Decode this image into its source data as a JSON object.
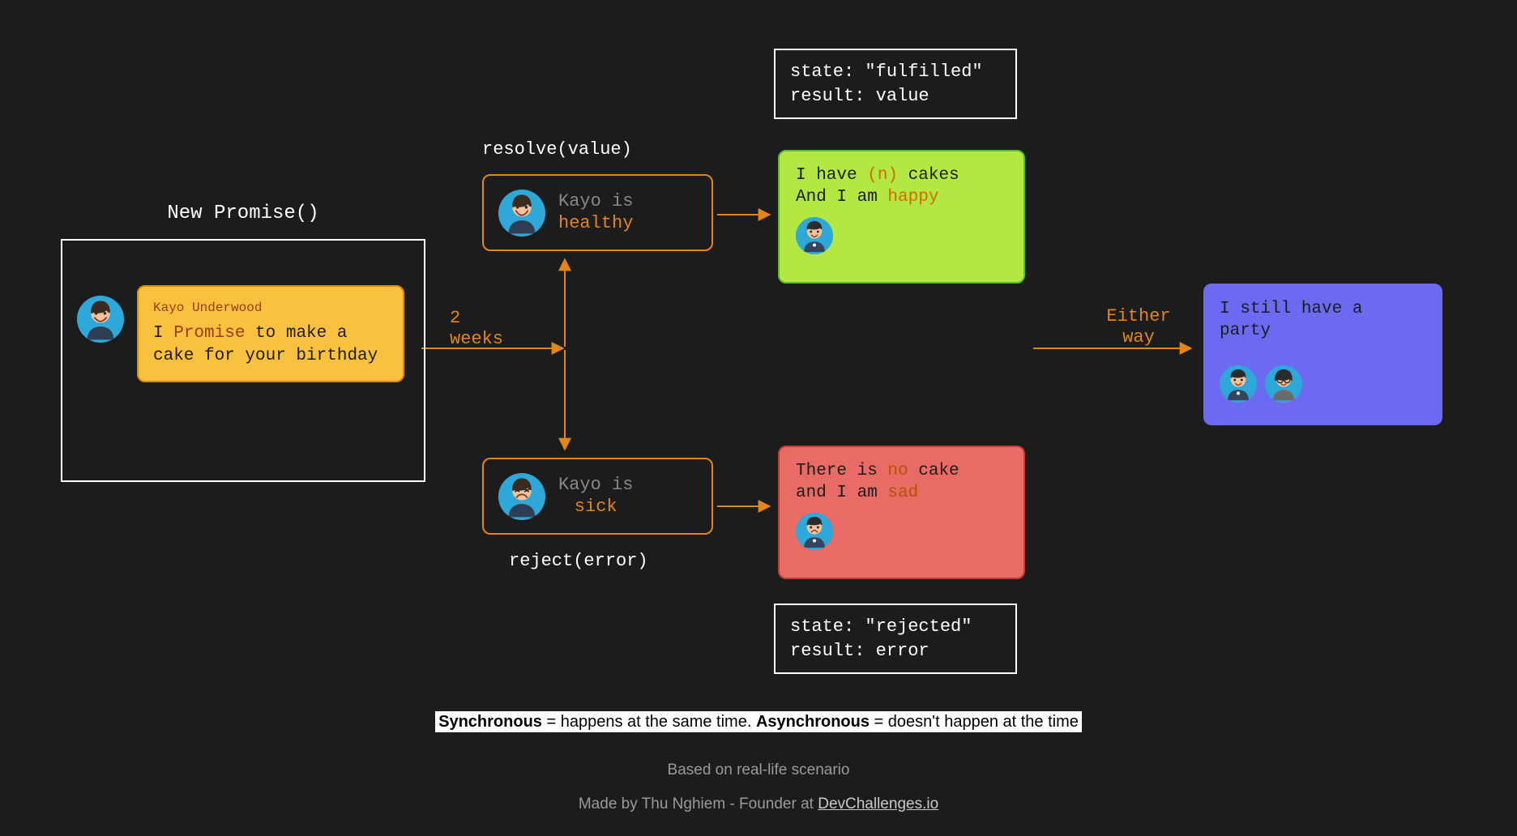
{
  "promise": {
    "title": "New Promise()",
    "author": "Kayo Underwood",
    "line_pre": "I ",
    "line_hl": "Promise",
    "line_post": " to make a cake for your birthday"
  },
  "edge": {
    "two_weeks_l1": "2",
    "two_weeks_l2": "weeks",
    "resolve": "resolve(value)",
    "reject": "reject(error)",
    "either_l1": "Either",
    "either_l2": "way"
  },
  "healthy": {
    "l1": "Kayo is",
    "l2": "healthy"
  },
  "sick": {
    "l1": "Kayo is",
    "l2": "sick"
  },
  "fulfilled_box": {
    "l1": "state: \"fulfilled\"",
    "l2": "result: value"
  },
  "rejected_box": {
    "l1": "state: \"rejected\"",
    "l2": "result: error"
  },
  "green": {
    "pre1": "I have ",
    "hl1": "(n)",
    "post1": " cakes",
    "pre2": "And I am ",
    "hl2": "happy"
  },
  "red": {
    "pre1": "There is ",
    "hl1": "no",
    "post1": " cake",
    "pre2": "and I am ",
    "hl2": "sad"
  },
  "blue": {
    "l1": "I still have a",
    "l2": "party"
  },
  "footer": {
    "sync_label": "Synchronous",
    "sync_def": " = happens at the same time. ",
    "async_label": "Asynchronous",
    "async_def": " = doesn't happen at the time",
    "based": "Based on real-life scenario",
    "made_pre": "Made by Thu Nghiem - Founder at ",
    "made_link": "DevChallenges.io"
  }
}
